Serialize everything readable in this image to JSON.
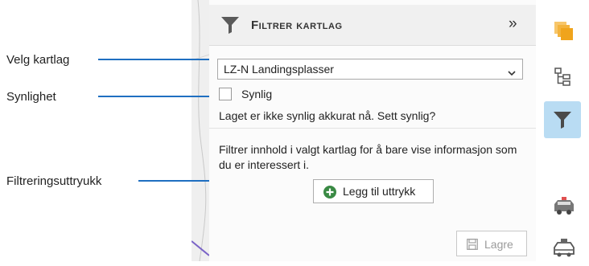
{
  "callouts": {
    "layer": "Velg kartlag",
    "visibility": "Synlighet",
    "expression": "Filtreringsuttryukk"
  },
  "panel": {
    "title": "Filtrer kartlag",
    "collapse_glyph": "»",
    "layer_select": {
      "value": "LZ-N Landingsplasser"
    },
    "visible_checkbox": {
      "label": "Synlig",
      "checked": false
    },
    "visibility_message": "Laget er ikke synlig akkurat nå. Sett synlig?",
    "filter_description": "Filtrer innhold i valgt kartlag for å bare vise informasjon som du er interessert i.",
    "add_expression_label": "Legg til uttrykk",
    "save_label": "Lagre"
  },
  "rail": {
    "items": [
      {
        "icon": "layers-icon",
        "active": false
      },
      {
        "icon": "tree-icon",
        "active": false
      },
      {
        "icon": "filter-icon",
        "active": true
      },
      {
        "icon": "emergency-vehicle-icon",
        "active": false
      },
      {
        "icon": "police-car-icon",
        "active": false
      }
    ]
  },
  "colors": {
    "accent": "#1f6fc1",
    "active_rail": "#b9dcf3",
    "layers_icon": "#f0a41c",
    "add_icon": "#3a8a44"
  }
}
